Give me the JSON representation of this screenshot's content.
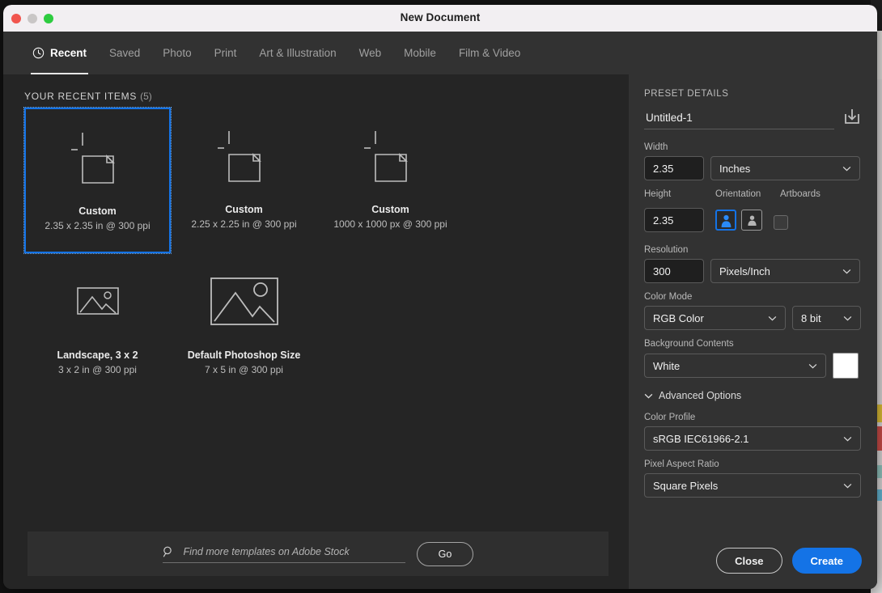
{
  "window": {
    "title": "New Document",
    "traffic_lights": [
      "close-red",
      "minimize-yellow",
      "maximize-green"
    ]
  },
  "tabs": [
    {
      "label": "Recent",
      "icon": "clock-icon",
      "active": true
    },
    {
      "label": "Saved",
      "icon": "",
      "active": false
    },
    {
      "label": "Photo",
      "icon": "",
      "active": false
    },
    {
      "label": "Print",
      "icon": "",
      "active": false
    },
    {
      "label": "Art & Illustration",
      "icon": "",
      "active": false
    },
    {
      "label": "Web",
      "icon": "",
      "active": false
    },
    {
      "label": "Mobile",
      "icon": "",
      "active": false
    },
    {
      "label": "Film & Video",
      "icon": "",
      "active": false
    }
  ],
  "recent": {
    "heading": "YOUR RECENT ITEMS",
    "count": "(5)",
    "items": [
      {
        "name": "Custom",
        "meta": "2.35 x 2.35 in @ 300 ppi",
        "icon": "document-icon",
        "selected": true
      },
      {
        "name": "Custom",
        "meta": "2.25 x 2.25 in @ 300 ppi",
        "icon": "document-icon",
        "selected": false
      },
      {
        "name": "Custom",
        "meta": "1000 x 1000 px @ 300 ppi",
        "icon": "document-icon",
        "selected": false
      },
      {
        "name": "Landscape, 3 x 2",
        "meta": "3 x 2 in @ 300 ppi",
        "icon": "photo-icon",
        "selected": false
      },
      {
        "name": "Default Photoshop Size",
        "meta": "7 x 5 in @ 300 ppi",
        "icon": "photo-icon",
        "selected": false
      }
    ]
  },
  "stock": {
    "placeholder": "Find more templates on Adobe Stock",
    "value": "",
    "go_label": "Go",
    "icon": "search-icon"
  },
  "preset": {
    "heading": "PRESET DETAILS",
    "doc_name": "Untitled-1",
    "save_preset_icon": "save-preset-icon",
    "width_label": "Width",
    "width_value": "2.35",
    "width_unit": "Inches",
    "height_label": "Height",
    "height_value": "2.35",
    "orientation_label": "Orientation",
    "orientation_selected": "portrait",
    "artboards_label": "Artboards",
    "artboards_checked": false,
    "resolution_label": "Resolution",
    "resolution_value": "300",
    "resolution_unit": "Pixels/Inch",
    "color_mode_label": "Color Mode",
    "color_mode_value": "RGB Color",
    "bit_depth_value": "8 bit",
    "background_label": "Background Contents",
    "background_value": "White",
    "background_swatch": "#ffffff",
    "advanced_label": "Advanced Options",
    "color_profile_label": "Color Profile",
    "color_profile_value": "sRGB IEC61966-2.1",
    "pixel_ratio_label": "Pixel Aspect Ratio",
    "pixel_ratio_value": "Square Pixels"
  },
  "footer": {
    "close_label": "Close",
    "create_label": "Create"
  },
  "colors": {
    "accent_blue": "#1473e6",
    "left_panel": "#252525",
    "right_panel": "#323232",
    "tab_bar": "#323232",
    "titlebar": "#f2eff2"
  }
}
